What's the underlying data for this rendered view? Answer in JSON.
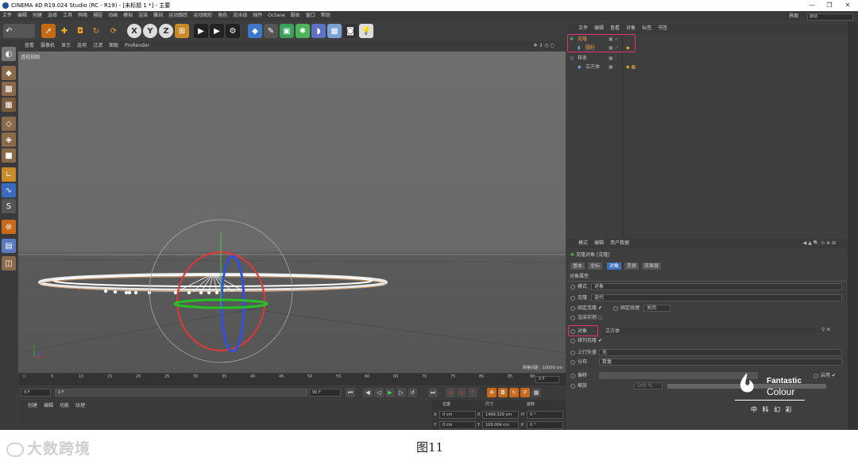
{
  "window": {
    "title": "CINEMA 4D R19.024 Studio (RC - R19) - [未标题 1 *] - 主要",
    "controls": [
      "—",
      "❐",
      "✕"
    ]
  },
  "menu": [
    "文件",
    "编辑",
    "创建",
    "选择",
    "工具",
    "网格",
    "捕捉",
    "动画",
    "模拟",
    "渲染",
    "雕刻",
    "运动跟踪",
    "运动图形",
    "角色",
    "流水线",
    "插件",
    "Octane",
    "脚本",
    "窗口",
    "帮助"
  ],
  "layout_label": "界面",
  "layout_value": "启动",
  "viewport": {
    "menu": [
      "查看",
      "摄像机",
      "显示",
      "选项",
      "过滤",
      "面板",
      "ProRender"
    ],
    "label": "透视视图",
    "grid_distance": "网格间距 : 10000 cm"
  },
  "timeline": {
    "ticks": [
      "0",
      "5",
      "10",
      "15",
      "20",
      "25",
      "30",
      "35",
      "40",
      "45",
      "50",
      "55",
      "60",
      "65",
      "70",
      "75",
      "80",
      "85",
      "90"
    ],
    "current_frame": "0 F"
  },
  "transport": {
    "start": "0 F",
    "min": "0 F",
    "max": "90 F",
    "end": "90 F"
  },
  "material_tabs": [
    "创建",
    "编辑",
    "功能",
    "纹理"
  ],
  "coords": {
    "headers": [
      "位置",
      "尺寸",
      "旋转"
    ],
    "rows": [
      {
        "axis": "X",
        "pos": "0 cm",
        "size_axis": "X",
        "size": "1499.329 cm",
        "rot_axis": "H",
        "rot": "0 °"
      },
      {
        "axis": "Y",
        "pos": "0 cm",
        "size_axis": "Y",
        "size": "109.004 cm",
        "rot_axis": "P",
        "rot": "0 °"
      }
    ]
  },
  "object_manager": {
    "menu": [
      "文件",
      "编辑",
      "查看",
      "对象",
      "标签",
      "书签"
    ],
    "objects": [
      {
        "name": "克隆",
        "indent": 0
      },
      {
        "name": "圆柱",
        "indent": 1
      },
      {
        "name": "样条",
        "indent": 0
      },
      {
        "name": "立方体",
        "indent": 1
      }
    ]
  },
  "attributes": {
    "menu": [
      "模式",
      "编辑",
      "用户数据"
    ],
    "object_title": "克隆对象 [克隆]",
    "tabs": [
      "基本",
      "坐标",
      "对象",
      "变换",
      "效果器"
    ],
    "active_tab": "对象",
    "section": "对象属性",
    "mode_label": "模式",
    "mode_value": "对象",
    "clone_label": "克隆",
    "clone_value": "迭代",
    "fix_clone_label": "固定克隆",
    "fix_tex_label": "固定纹理",
    "fix_tex_value": "关闭",
    "render_inst_label": "渲染实例",
    "object_label": "对象",
    "object_value": "立方体",
    "arrange_label": "排列克隆",
    "up_vector_label": "上行矢量",
    "up_vector_value": "无",
    "distribution_label": "分布",
    "distribution_value": "数量",
    "offset_label": "偏移",
    "enable_label": "启用",
    "scale_label": "缩放",
    "scale_value": "100 %"
  },
  "brand": {
    "line1": "Fantastic",
    "line2": "Colour",
    "cn": "中 科 幻 彩"
  },
  "caption": "图11",
  "watermark": "大数跨境"
}
